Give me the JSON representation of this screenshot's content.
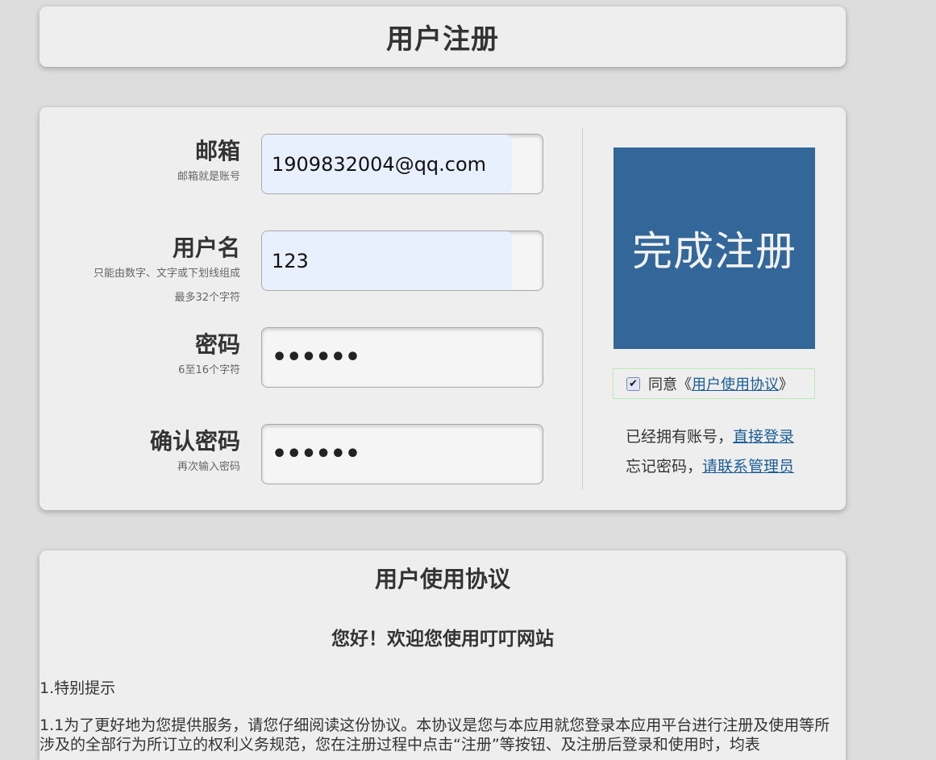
{
  "header": {
    "title": "用户注册"
  },
  "form": {
    "email": {
      "label": "邮箱",
      "hint": "邮箱就是账号",
      "value": "1909832004@qq.com"
    },
    "username": {
      "label": "用户名",
      "hint_line1": "只能由数字、文字或下划线组成",
      "hint_line2": "最多32个字符",
      "value": "123"
    },
    "password": {
      "label": "密码",
      "hint": "6至16个字符",
      "masked": "••••••"
    },
    "confirm_password": {
      "label": "确认密码",
      "hint": "再次输入密码",
      "masked": "••••••"
    }
  },
  "side": {
    "submit_label": "完成注册",
    "agree": {
      "checked": true,
      "check_glyph": "✔",
      "prefix": "同意《",
      "link": "用户使用协议",
      "suffix": "》"
    },
    "have_account_text": "已经拥有账号，",
    "login_link": "直接登录",
    "forgot_text": "忘记密码，",
    "contact_link": "请联系管理员"
  },
  "agreement": {
    "title": "用户使用协议",
    "welcome": "您好！欢迎您使用叮叮网站",
    "section_1": "1.特别提示",
    "section_1_1": "1.1为了更好地为您提供服务，请您仔细阅读这份协议。本协议是您与本应用就您登录本应用平台进行注册及使用等所涉及的全部行为所订立的权利义务规范，您在注册过程中点击“注册”等按钮、及注册后登录和使用时，均表"
  },
  "colors": {
    "page_bg": "#dddddd",
    "panel_bg": "#eeeeee",
    "submit_bg": "#336699",
    "autofill_bg": "#e8f0fe",
    "link": "#1a5c96"
  }
}
